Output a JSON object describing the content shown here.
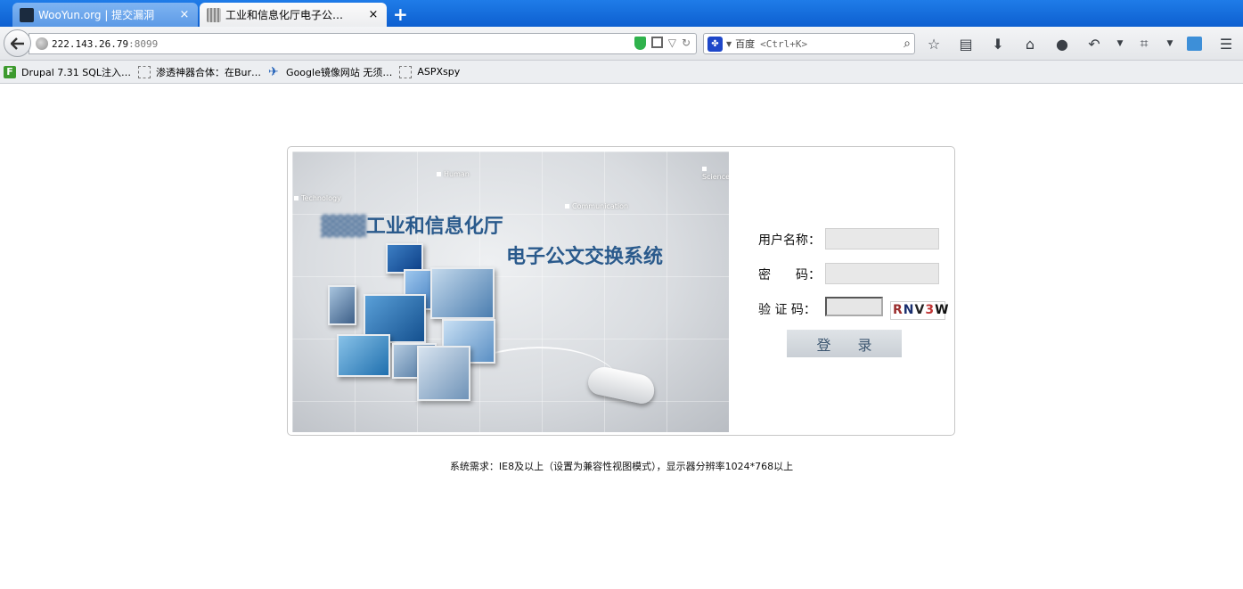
{
  "tabs": [
    {
      "label": "WooYun.org | 提交漏洞",
      "close": "×"
    },
    {
      "label": "工业和信息化厅电子公…",
      "close": "×"
    }
  ],
  "new_tab": "+",
  "nav": {
    "url_host": "222.143.26.79",
    "url_port": ":8099",
    "search_engine": "百度",
    "search_hint": "<Ctrl+K>"
  },
  "icons": {
    "back": "back-arrow-icon",
    "page": "globe-icon",
    "shield": "shield-icon",
    "qr": "qrcode-icon",
    "dropdown": "chevron-down-icon",
    "reload": "reload-icon",
    "search": "magnifier-icon",
    "bookmark_star": "star-icon",
    "reading_list": "clipboard-icon",
    "download": "download-icon",
    "home": "home-icon",
    "chat": "chat-icon",
    "undo": "undo-icon",
    "screenshot": "crop-icon",
    "addon": "addon-icon",
    "menu": "hamburger-menu-icon"
  },
  "bookmarks": [
    {
      "label": "Drupal 7.31 SQL注入…",
      "icon": "drupal-icon"
    },
    {
      "label": "渗透神器合体：在Bur…",
      "icon": "blank-page-icon"
    },
    {
      "label": "Google镜像网站 无须…",
      "icon": "bird-icon"
    },
    {
      "label": "ASPXspy",
      "icon": "blank-page-icon"
    }
  ],
  "banner": {
    "tags": [
      "Human",
      "Science",
      "Technology",
      "Communication"
    ],
    "title_line1": "工业和信息化厅",
    "title_line2": "电子公文交换系统"
  },
  "login": {
    "username_label": "用户名称：",
    "password_label": "密　　码：",
    "captcha_label": "验 证 码：",
    "captcha_chars": [
      "R",
      "N",
      "V",
      "3",
      "W"
    ],
    "submit_label": "登录"
  },
  "footer": {
    "requirements": "系统需求：IE8及以上（设置为兼容性视图模式），显示器分辨率1024*768以上"
  }
}
